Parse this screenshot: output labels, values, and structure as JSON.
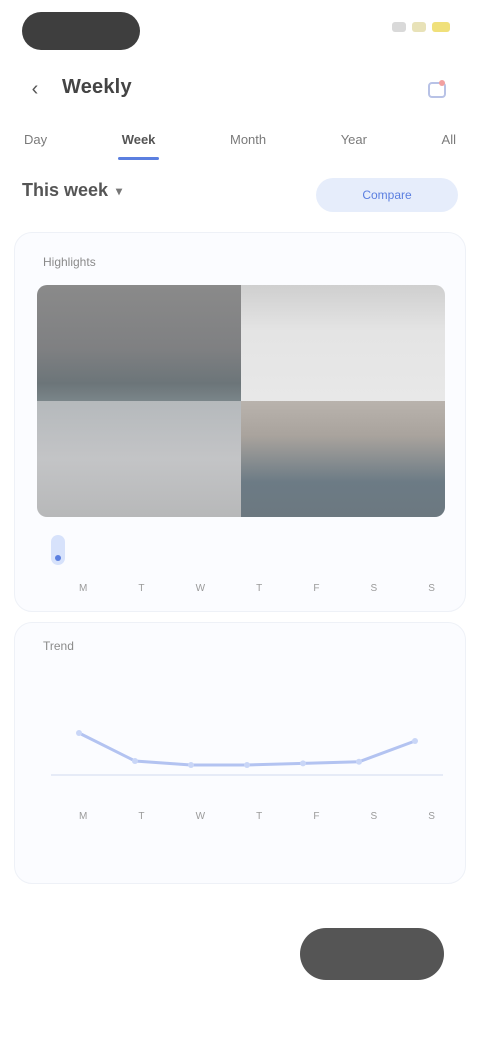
{
  "status_bar": {
    "time": "",
    "icons": [
      "signal-icon",
      "wifi-icon",
      "battery-icon"
    ],
    "icon_colors": [
      "#d9d9d9",
      "#e8e2b8",
      "#f0e07a"
    ]
  },
  "header": {
    "title": "Weekly",
    "back_icon": "chevron-left-icon",
    "action_icon": "calendar-icon",
    "accent": "#5b7fe0"
  },
  "tabs": [
    {
      "label": "Day"
    },
    {
      "label": "Week"
    },
    {
      "label": "Month"
    },
    {
      "label": "Year"
    },
    {
      "label": "All"
    }
  ],
  "range": {
    "label": "This week",
    "chip": "Compare"
  },
  "card_a": {
    "label": "Highlights",
    "value": "",
    "days": [
      "M",
      "T",
      "W",
      "T",
      "F",
      "S",
      "S"
    ]
  },
  "card_b": {
    "label": "Trend",
    "days": [
      "M",
      "T",
      "W",
      "T",
      "F",
      "S",
      "S"
    ],
    "series": [
      0.7,
      0.35,
      0.3,
      0.3,
      0.32,
      0.34,
      0.6
    ]
  },
  "footer_note": "",
  "bottom": {
    "hint": "",
    "button_label": ""
  }
}
